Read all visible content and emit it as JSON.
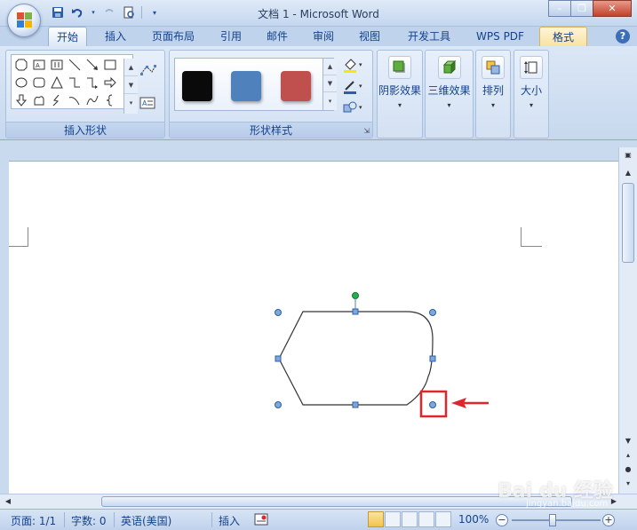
{
  "window": {
    "title": "文档 1 - Microsoft Word",
    "minimize": "–",
    "restore": "❐",
    "close": "✕"
  },
  "tabs": [
    {
      "label": "开始",
      "active": true
    },
    {
      "label": "插入"
    },
    {
      "label": "页面布局"
    },
    {
      "label": "引用"
    },
    {
      "label": "邮件"
    },
    {
      "label": "审阅"
    },
    {
      "label": "视图"
    },
    {
      "label": "开发工具"
    },
    {
      "label": "WPS PDF"
    },
    {
      "label": "格式",
      "contextual": true
    }
  ],
  "help_label": "?",
  "ribbon": {
    "insert_shapes": {
      "label": "插入形状"
    },
    "shape_styles": {
      "label": "形状样式",
      "swatches": [
        "#0a0a0a",
        "#4f81bd",
        "#c0504d"
      ]
    },
    "shadow_effects": {
      "label": "阴影效果"
    },
    "3d_effects": {
      "label": "三维效果"
    },
    "arrange": {
      "label": "排列"
    },
    "size": {
      "label": "大小"
    }
  },
  "statusbar": {
    "page": "页面: 1/1",
    "word_count": "字数: 0",
    "language": "英语(美国)",
    "insert_mode": "插入",
    "zoom": "100%"
  },
  "watermark": {
    "text": "Bai du 经验",
    "url": "jingyan.baidu.com"
  },
  "colors": {
    "handle": "#4f81bd",
    "rotate_handle": "#22b14c",
    "highlight_box": "#e0262b",
    "arrow": "#e0262b"
  }
}
